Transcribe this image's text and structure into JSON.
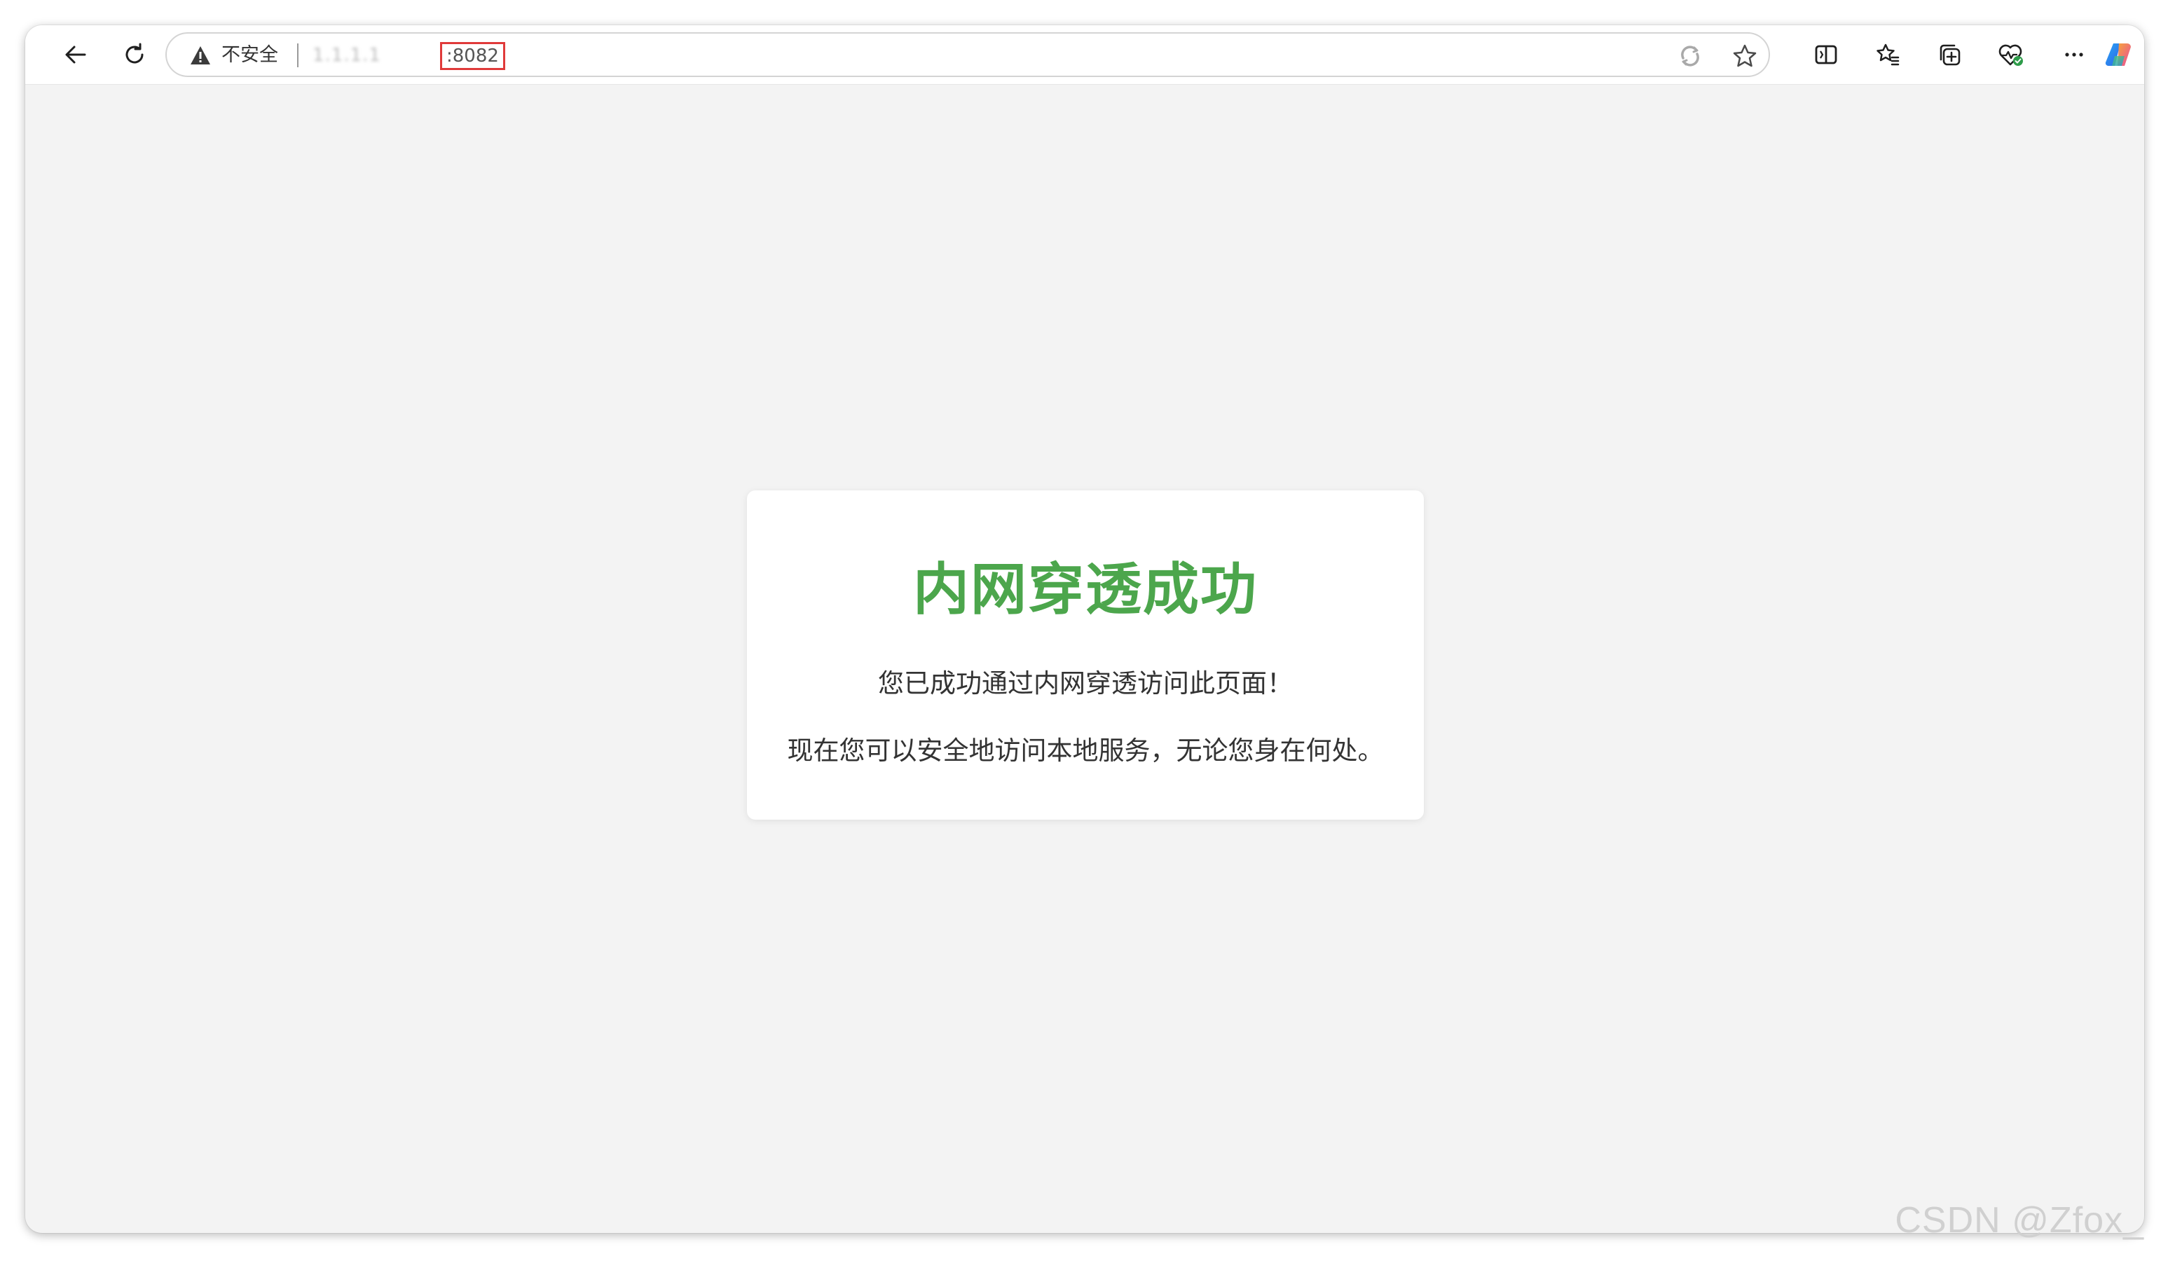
{
  "browser": {
    "security_label": "不安全",
    "url_host": "1.1.1.1",
    "url_port": ":8082",
    "icons": [
      "back-arrow-icon",
      "refresh-icon",
      "warning-icon",
      "read-aloud-icon",
      "favorite-star-icon",
      "split-screen-icon",
      "favorites-icon",
      "collections-icon",
      "browser-essentials-icon",
      "more-icon",
      "copilot-icon"
    ]
  },
  "page": {
    "title": "内网穿透成功",
    "line1": "您已成功通过内网穿透访问此页面！",
    "line2": "现在您可以安全地访问本地服务，无论您身在何处。"
  },
  "colors": {
    "title_green": "#4ca64c",
    "port_highlight": "#e03a3a",
    "page_background": "#f3f3f3"
  },
  "watermark": "CSDN @Zfox_"
}
